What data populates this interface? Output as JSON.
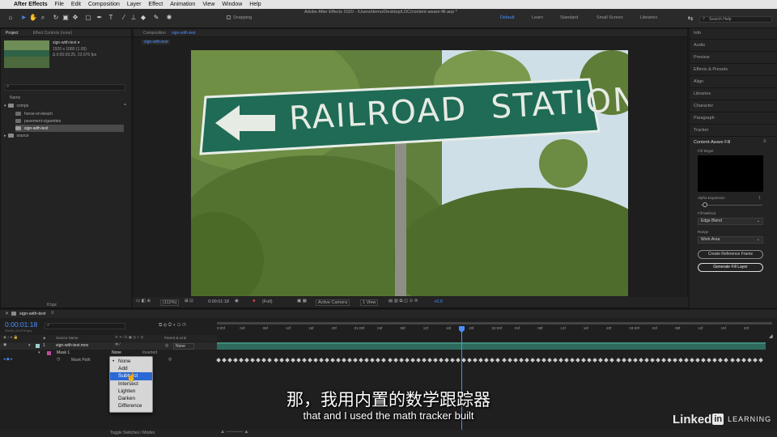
{
  "menubar": {
    "items": [
      "After Effects",
      "File",
      "Edit",
      "Composition",
      "Layer",
      "Effect",
      "Animation",
      "View",
      "Window",
      "Help"
    ],
    "title": "Adobe After Effects 2020 - /Users/demo/Desktop/LDC/content-aware-fill.aep *"
  },
  "toolbar": {
    "snapping": "Snapping",
    "workspaces": [
      "Default",
      "Learn",
      "Standard",
      "Small Screen",
      "Libraries"
    ],
    "search_placeholder": "Search Help"
  },
  "project": {
    "tabs": [
      "Project",
      "Effect Controls (none)"
    ],
    "selected_name": "sign-with-text ▾",
    "selected_info1": "1920 x 1080 (1.00)",
    "selected_info2": "Δ 0;00;03;25, 23.976 fps",
    "name_col": "Name",
    "items": [
      "comps",
      "horse-on-beach",
      "pavement-cigarettes",
      "sign-with-text",
      "source"
    ],
    "bpc": "8 bpc"
  },
  "comp": {
    "header": "Composition",
    "name": "sign-with-text",
    "tab": "sign-with-text",
    "sign_text": "RAILROAD  STATION"
  },
  "viewer_bar": {
    "zoom": "(112%)",
    "time": "0:00:01:18",
    "res": "(Full)",
    "camera": "Active Camera",
    "view": "1 View",
    "exposure": "+0.0"
  },
  "right_panel": {
    "items": [
      "Info",
      "Audio",
      "Preview",
      "Effects & Presets",
      "Align",
      "Libraries",
      "Character",
      "Paragraph",
      "Tracker"
    ],
    "caf_title": "Content-Aware Fill",
    "fill_target": "Fill Target",
    "alpha_expansion": "Alpha Expansion",
    "alpha_value": "1",
    "fill_method_label": "Fill Method",
    "fill_method": "Edge Blend",
    "range_label": "Range",
    "range": "Work Area",
    "create_ref": "Create Reference Frame",
    "generate": "Generate Fill Layer"
  },
  "timeline": {
    "tab": "sign-with-text",
    "timecode": "0:00:01:18",
    "timecode_sub": "00042 (23.976 fps)",
    "source_name_col": "Source Name",
    "parent_col": "Parent & Link",
    "layer_num": "1",
    "layer_name": "sign-with-text.mov",
    "parent_value": "None",
    "mask_name": "Mask 1",
    "mask_mode": "None",
    "inverted": "Inverted",
    "mask_path": "Mask Path",
    "toggle_label": "Toggle Switches / Modes",
    "ticks": [
      "0:00f",
      "04f",
      "08f",
      "12f",
      "16f",
      "20f",
      "01:00f",
      "04f",
      "08f",
      "12f",
      "16f",
      "20f",
      "02:00f",
      "04f",
      "08f",
      "12f",
      "16f",
      "20f",
      "03:00f",
      "04f",
      "08f",
      "12f",
      "16f",
      "20f"
    ]
  },
  "mask_menu": {
    "options": [
      "None",
      "Add",
      "Subtract",
      "Intersect",
      "Lighten",
      "Darken",
      "Difference"
    ],
    "selected": "Subtract"
  },
  "subtitles": {
    "chinese": "那，我用内置的数学跟踪器",
    "english": "that and I used the math tracker built"
  },
  "brand": {
    "linked": "Linked",
    "in": "in",
    "learning": "LEARNING"
  }
}
